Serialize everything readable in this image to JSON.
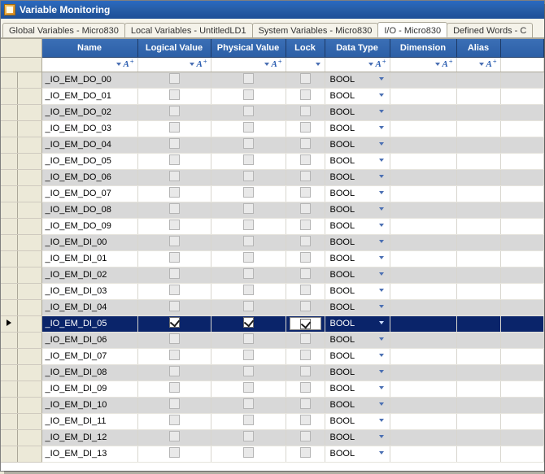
{
  "title": "Variable Monitoring",
  "tabs": [
    {
      "label": "Global Variables - Micro830",
      "active": false
    },
    {
      "label": "Local Variables - UntitledLD1",
      "active": false
    },
    {
      "label": "System Variables - Micro830",
      "active": false
    },
    {
      "label": "I/O - Micro830",
      "active": true
    },
    {
      "label": "Defined Words - C",
      "active": false
    }
  ],
  "columns": {
    "name": "Name",
    "logical": "Logical Value",
    "physical": "Physical Value",
    "lock": "Lock",
    "datatype": "Data Type",
    "dimension": "Dimension",
    "alias": "Alias"
  },
  "datatype_value": "BOOL",
  "rows": [
    {
      "name": "_IO_EM_DO_00",
      "logical": false,
      "physical": false,
      "lock": false,
      "datatype": "BOOL",
      "selected": false
    },
    {
      "name": "_IO_EM_DO_01",
      "logical": false,
      "physical": false,
      "lock": false,
      "datatype": "BOOL",
      "selected": false
    },
    {
      "name": "_IO_EM_DO_02",
      "logical": false,
      "physical": false,
      "lock": false,
      "datatype": "BOOL",
      "selected": false
    },
    {
      "name": "_IO_EM_DO_03",
      "logical": false,
      "physical": false,
      "lock": false,
      "datatype": "BOOL",
      "selected": false
    },
    {
      "name": "_IO_EM_DO_04",
      "logical": false,
      "physical": false,
      "lock": false,
      "datatype": "BOOL",
      "selected": false
    },
    {
      "name": "_IO_EM_DO_05",
      "logical": false,
      "physical": false,
      "lock": false,
      "datatype": "BOOL",
      "selected": false
    },
    {
      "name": "_IO_EM_DO_06",
      "logical": false,
      "physical": false,
      "lock": false,
      "datatype": "BOOL",
      "selected": false
    },
    {
      "name": "_IO_EM_DO_07",
      "logical": false,
      "physical": false,
      "lock": false,
      "datatype": "BOOL",
      "selected": false
    },
    {
      "name": "_IO_EM_DO_08",
      "logical": false,
      "physical": false,
      "lock": false,
      "datatype": "BOOL",
      "selected": false
    },
    {
      "name": "_IO_EM_DO_09",
      "logical": false,
      "physical": false,
      "lock": false,
      "datatype": "BOOL",
      "selected": false
    },
    {
      "name": "_IO_EM_DI_00",
      "logical": false,
      "physical": false,
      "lock": false,
      "datatype": "BOOL",
      "selected": false
    },
    {
      "name": "_IO_EM_DI_01",
      "logical": false,
      "physical": false,
      "lock": false,
      "datatype": "BOOL",
      "selected": false
    },
    {
      "name": "_IO_EM_DI_02",
      "logical": false,
      "physical": false,
      "lock": false,
      "datatype": "BOOL",
      "selected": false
    },
    {
      "name": "_IO_EM_DI_03",
      "logical": false,
      "physical": false,
      "lock": false,
      "datatype": "BOOL",
      "selected": false
    },
    {
      "name": "_IO_EM_DI_04",
      "logical": false,
      "physical": false,
      "lock": false,
      "datatype": "BOOL",
      "selected": false
    },
    {
      "name": "_IO_EM_DI_05",
      "logical": true,
      "physical": true,
      "lock": true,
      "datatype": "BOOL",
      "selected": true
    },
    {
      "name": "_IO_EM_DI_06",
      "logical": false,
      "physical": false,
      "lock": false,
      "datatype": "BOOL",
      "selected": false
    },
    {
      "name": "_IO_EM_DI_07",
      "logical": false,
      "physical": false,
      "lock": false,
      "datatype": "BOOL",
      "selected": false
    },
    {
      "name": "_IO_EM_DI_08",
      "logical": false,
      "physical": false,
      "lock": false,
      "datatype": "BOOL",
      "selected": false
    },
    {
      "name": "_IO_EM_DI_09",
      "logical": false,
      "physical": false,
      "lock": false,
      "datatype": "BOOL",
      "selected": false
    },
    {
      "name": "_IO_EM_DI_10",
      "logical": false,
      "physical": false,
      "lock": false,
      "datatype": "BOOL",
      "selected": false
    },
    {
      "name": "_IO_EM_DI_11",
      "logical": false,
      "physical": false,
      "lock": false,
      "datatype": "BOOL",
      "selected": false
    },
    {
      "name": "_IO_EM_DI_12",
      "logical": false,
      "physical": false,
      "lock": false,
      "datatype": "BOOL",
      "selected": false
    },
    {
      "name": "_IO_EM_DI_13",
      "logical": false,
      "physical": false,
      "lock": false,
      "datatype": "BOOL",
      "selected": false
    }
  ]
}
